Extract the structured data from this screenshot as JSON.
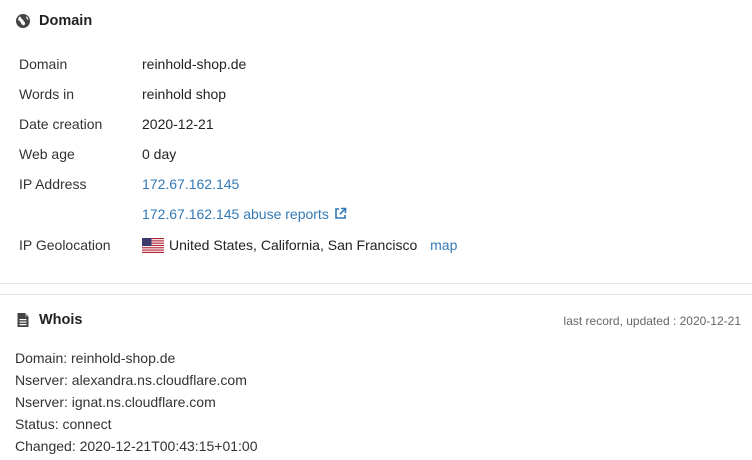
{
  "domain_panel": {
    "title": "Domain",
    "rows": [
      {
        "label": "Domain",
        "value": "reinhold-shop.de"
      },
      {
        "label": "Words in",
        "value": "reinhold shop"
      },
      {
        "label": "Date creation",
        "value": "2020-12-21"
      },
      {
        "label": "Web age",
        "value": "0 day"
      },
      {
        "label": "IP Address",
        "value": "172.67.162.145"
      }
    ],
    "abuse_link": "172.67.162.145 abuse reports",
    "geo_label": "IP Geolocation",
    "geo_value": "United States, California, San Francisco",
    "map_link": "map"
  },
  "whois_panel": {
    "title": "Whois",
    "updated": "last record, updated : 2020-12-21",
    "lines": [
      "Domain: reinhold-shop.de",
      "Nserver: alexandra.ns.cloudflare.com",
      "Nserver: ignat.ns.cloudflare.com",
      "Status: connect",
      "Changed: 2020-12-21T00:43:15+01:00"
    ]
  },
  "colors": {
    "link": "#337ab7",
    "text": "#333333",
    "divider": "#e6e6e6"
  },
  "icons": {
    "domain": "globe-icon",
    "whois": "document-icon",
    "external": "external-link-icon",
    "flag": "us-flag-icon"
  }
}
